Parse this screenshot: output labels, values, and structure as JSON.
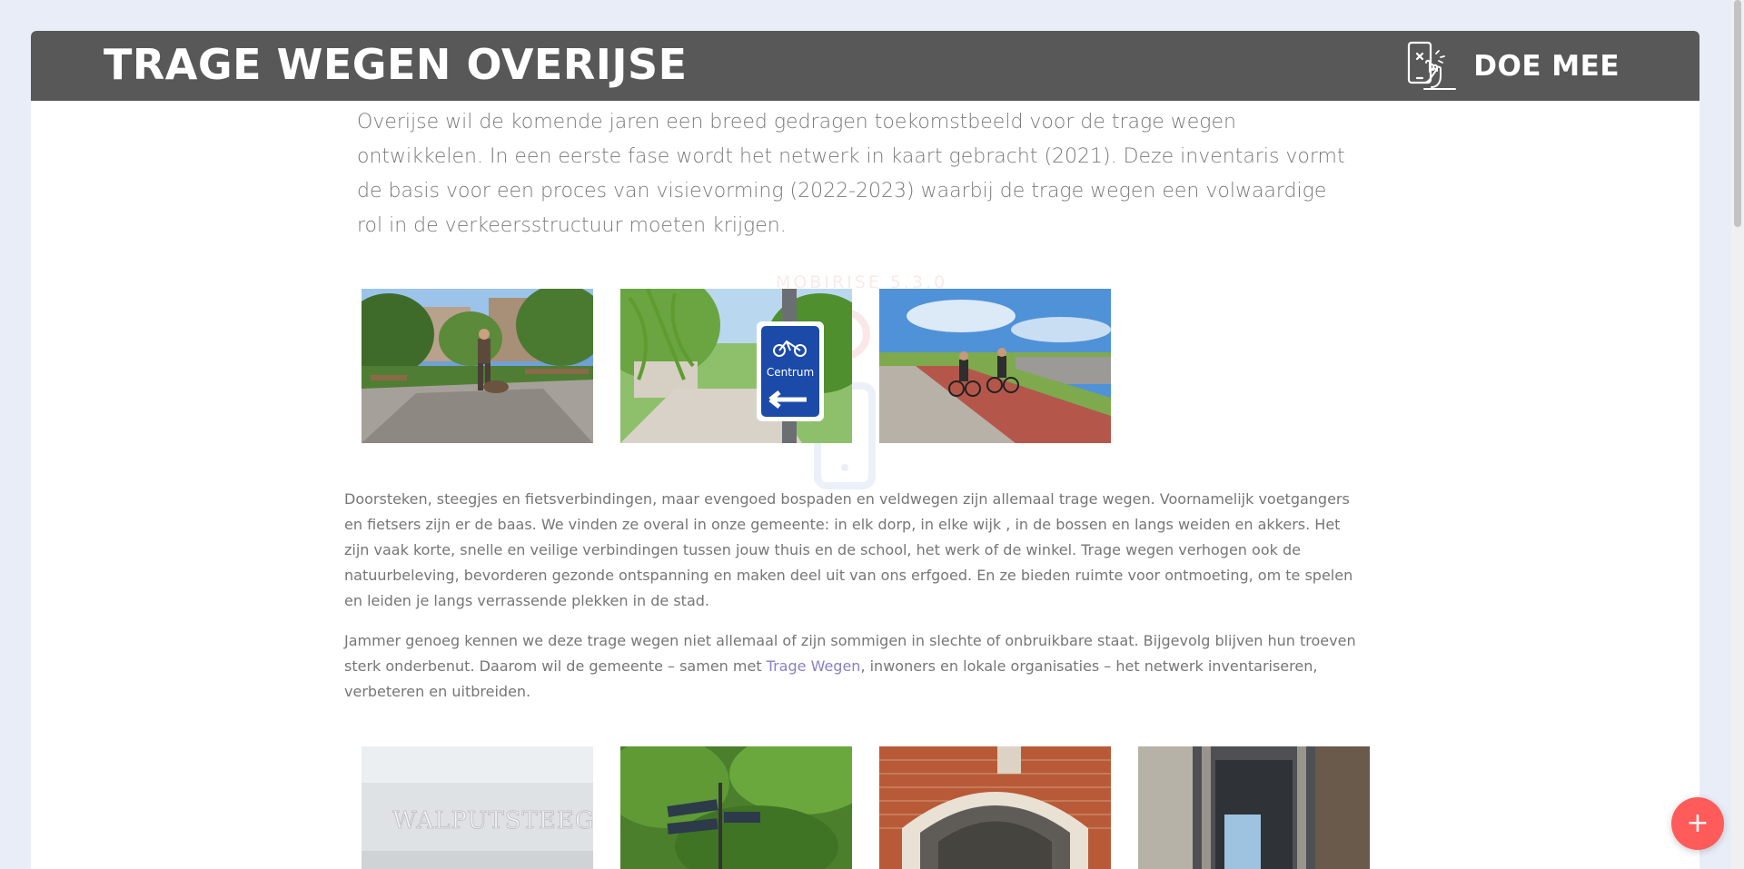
{
  "header": {
    "title": "TRAGE WEGEN OVERIJSE",
    "cta_label": "DOE MEE",
    "cta_icon": "touch-screen-phone-icon"
  },
  "intro": "Overijse wil de komende jaren een breed gedragen toekomstbeeld voor de trage wegen ontwikkelen. In een eerste fase wordt het netwerk in kaart gebracht (2021). Deze inventaris vormt de basis voor een proces van visievorming (2022-2023) waarbij de trage wegen een volwaardige rol in de verkeersstructuur moeten krijgen.",
  "watermark": {
    "text": "MOBIRISE  5.3.0"
  },
  "gallery_top": [
    {
      "name": "photo-man-with-dog-on-path"
    },
    {
      "name": "photo-cyclist-sign-centrum",
      "sign_text": "Centrum"
    },
    {
      "name": "photo-cyclists-on-red-bike-path"
    }
  ],
  "paragraphs": {
    "p1": "Doorsteken, steegjes en fietsverbindingen, maar evengoed bospaden en veldwegen zijn allemaal trage wegen. Voornamelijk voetgangers en fietsers zijn er de baas. We vinden ze overal in onze gemeente: in elk dorp, in elke wijk , in de bossen en langs weiden en akkers. Het zijn vaak korte, snelle en veilige verbindingen tussen jouw thuis en de school, het werk of de winkel. Trage wegen verhogen ook de natuurbeleving, bevorderen gezonde ontspanning en maken deel uit van ons erfgoed. En ze bieden ruimte voor ontmoeting, om te spelen en leiden je langs verrassende plekken in de stad.",
    "p2_before": "Jammer genoeg kennen we deze trage wegen niet allemaal of zijn sommigen in slechte of onbruikbare staat. Bijgevolg blijven hun troeven sterk onderbenut. Daarom wil de gemeente – samen met ",
    "p2_link": "Trage Wegen",
    "p2_after": ", inwoners en lokale organisaties – het netwerk inventariseren, verbeteren en uitbreiden."
  },
  "gallery_bottom": [
    {
      "name": "photo-walputsteeg-sign",
      "sign_text": "WALPUTSTEEG"
    },
    {
      "name": "photo-ivy-wall-street-signs"
    },
    {
      "name": "photo-brick-archway"
    },
    {
      "name": "photo-stone-passage"
    }
  ],
  "fab": {
    "label": "+"
  },
  "colors": {
    "header_bg": "#585858",
    "fab": "#ff5b5b",
    "link": "#8a7fc4"
  }
}
